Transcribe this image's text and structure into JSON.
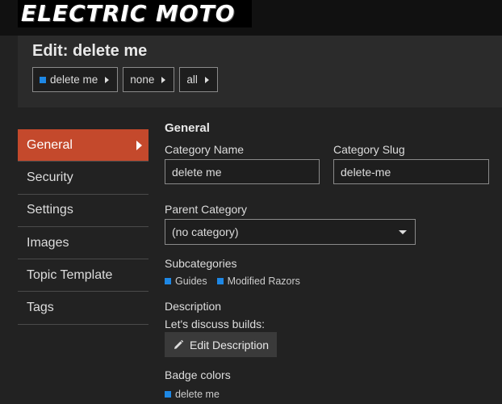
{
  "brand": {
    "logo_text": "ELECTRIC MOTO"
  },
  "header": {
    "title": "Edit: delete me",
    "breadcrumbs": [
      {
        "label": "delete me",
        "color": "#1e88e5"
      },
      {
        "label": "none"
      },
      {
        "label": "all"
      }
    ]
  },
  "sidebar": {
    "items": [
      {
        "label": "General",
        "active": true
      },
      {
        "label": "Security"
      },
      {
        "label": "Settings"
      },
      {
        "label": "Images"
      },
      {
        "label": "Topic Template"
      },
      {
        "label": "Tags"
      }
    ],
    "active_color": "#c4492c"
  },
  "form": {
    "section_title": "General",
    "category_name": {
      "label": "Category Name",
      "value": "delete me"
    },
    "category_slug": {
      "label": "Category Slug",
      "value": "delete-me"
    },
    "parent_category": {
      "label": "Parent Category",
      "value": "(no category)"
    },
    "subcategories": {
      "label": "Subcategories",
      "items": [
        {
          "label": "Guides",
          "color": "#1e88e5"
        },
        {
          "label": "Modified Razors",
          "color": "#1e88e5"
        }
      ]
    },
    "description": {
      "label": "Description",
      "text": "Let's discuss builds:",
      "edit_button": "Edit Description",
      "edit_icon": "pencil-icon"
    },
    "badge_colors": {
      "label": "Badge colors",
      "badge": {
        "label": "delete me",
        "color": "#1e88e5"
      }
    }
  }
}
